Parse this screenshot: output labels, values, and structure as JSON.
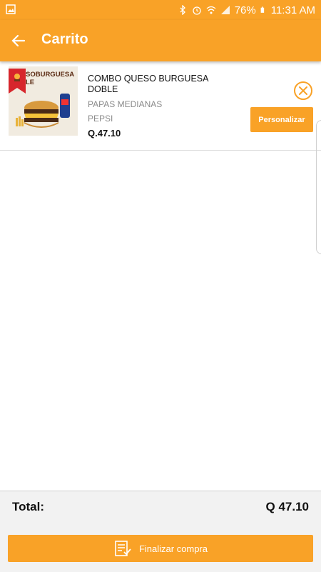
{
  "statusbar": {
    "battery_pct": "76%",
    "time": "11:31 AM",
    "icons": [
      "image-icon",
      "bluetooth-icon",
      "alarm-icon",
      "wifi-icon",
      "signal-icon",
      "battery-icon"
    ]
  },
  "appbar": {
    "title": "Carrito",
    "back_icon": "arrow-left-icon"
  },
  "cart_items": [
    {
      "image_text": "SOBURGUESA LE",
      "name": "COMBO QUESO BURGUESA DOBLE",
      "options": [
        "PAPAS MEDIANAS",
        "PEPSI"
      ],
      "price": "Q.47.10",
      "customize_label": "Personalizar",
      "remove_icon": "close-circle-icon"
    }
  ],
  "footer": {
    "total_label": "Total:",
    "total_value": "Q 47.10",
    "checkout_label": "Finalizar compra",
    "checkout_icon": "checklist-icon"
  },
  "colors": {
    "brand": "#f9a227",
    "background": "#ffffff",
    "footer_bg": "#f2f2f2"
  }
}
